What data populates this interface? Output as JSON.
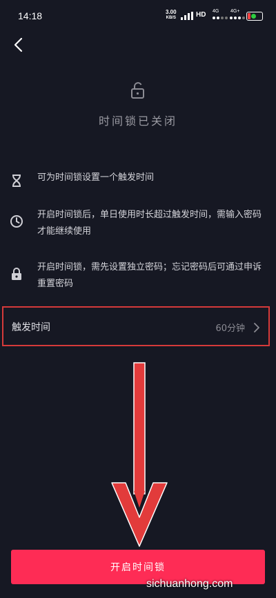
{
  "status_bar": {
    "time": "14:18",
    "speed_value": "3.00",
    "speed_unit": "KB/S",
    "hd": "HD",
    "net1": "4G",
    "net2": "4G+"
  },
  "header": {
    "title": "时间锁已关闭"
  },
  "features": [
    {
      "icon": "hourglass-icon",
      "text": "可为时间锁设置一个触发时间"
    },
    {
      "icon": "clock-icon",
      "text": "开启时间锁后，单日使用时长超过触发时间，需输入密码才能继续使用"
    },
    {
      "icon": "lock-icon",
      "text": "开启时间锁，需先设置独立密码；忘记密码后可通过申诉重置密码"
    }
  ],
  "setting": {
    "label": "触发时间",
    "value": "60分钟"
  },
  "cta": {
    "label": "开启时间锁"
  },
  "watermark": "sichuanhong.com",
  "colors": {
    "background": "#161823",
    "accent": "#fe2c55",
    "highlight": "#d63a3a"
  }
}
